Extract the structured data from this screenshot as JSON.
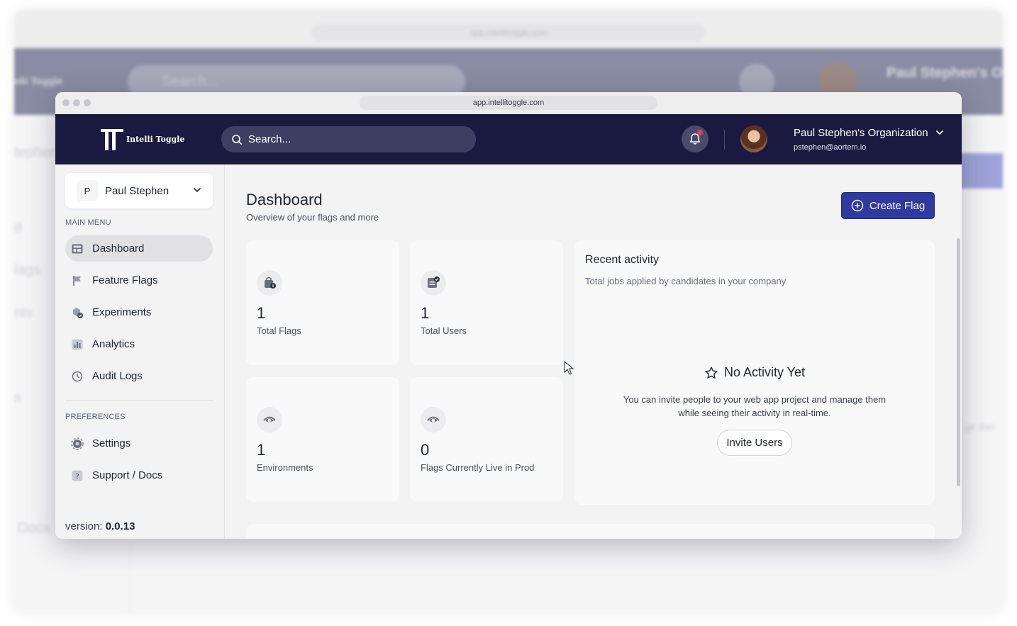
{
  "background": {
    "url": "app.intellitoggle.com",
    "logo_text": "elli Toggle",
    "search_placeholder": "Search...",
    "org_name": "Paul Stephen's Or",
    "side_texts": [
      "tephen",
      "d",
      "lags",
      "nts",
      "s",
      "Docs"
    ],
    "right_text": "ge ther"
  },
  "browser": {
    "url": "app.intellitoggle.com"
  },
  "header": {
    "logo_text": "Intelli Toggle",
    "search_placeholder": "Search...",
    "org_name": "Paul Stephen's Organization",
    "org_email": "pstephen@aortem.io"
  },
  "sidebar": {
    "user_initial": "P",
    "user_name": "Paul Stephen",
    "main_menu_label": "MAIN MENU",
    "main_items": [
      {
        "label": "Dashboard",
        "icon": "dashboard-icon",
        "active": true
      },
      {
        "label": "Feature Flags",
        "icon": "flag-icon"
      },
      {
        "label": "Experiments",
        "icon": "experiments-icon"
      },
      {
        "label": "Analytics",
        "icon": "analytics-icon"
      },
      {
        "label": "Audit Logs",
        "icon": "clock-icon"
      }
    ],
    "preferences_label": "PREFERENCES",
    "pref_items": [
      {
        "label": "Settings",
        "icon": "gear-icon"
      },
      {
        "label": "Support / Docs",
        "icon": "help-icon"
      }
    ],
    "version_label": "version:",
    "version_value": "0.0.13"
  },
  "main": {
    "title": "Dashboard",
    "subtitle": "Overview of your flags and more",
    "create_button": "Create Flag",
    "stats": [
      {
        "value": "1",
        "label": "Total Flags",
        "icon": "bag-info-icon"
      },
      {
        "value": "1",
        "label": "Total Users",
        "icon": "users-check-icon"
      },
      {
        "value": "1",
        "label": "Environments",
        "icon": "eye-icon"
      },
      {
        "value": "0",
        "label": "Flags Currently Live in Prod",
        "icon": "eye-icon"
      }
    ],
    "recent_activity": {
      "title": "Recent activity",
      "subtitle": "Total jobs applied by candidates in your company",
      "empty_title": "No Activity Yet",
      "empty_description": "You can invite people to your web app project and manage them while seeing their activity in real-time.",
      "invite_button": "Invite Users"
    }
  },
  "colors": {
    "header_bg": "#1a1a40",
    "primary_button": "#2f3aa0",
    "notification_dot": "#e54040"
  }
}
